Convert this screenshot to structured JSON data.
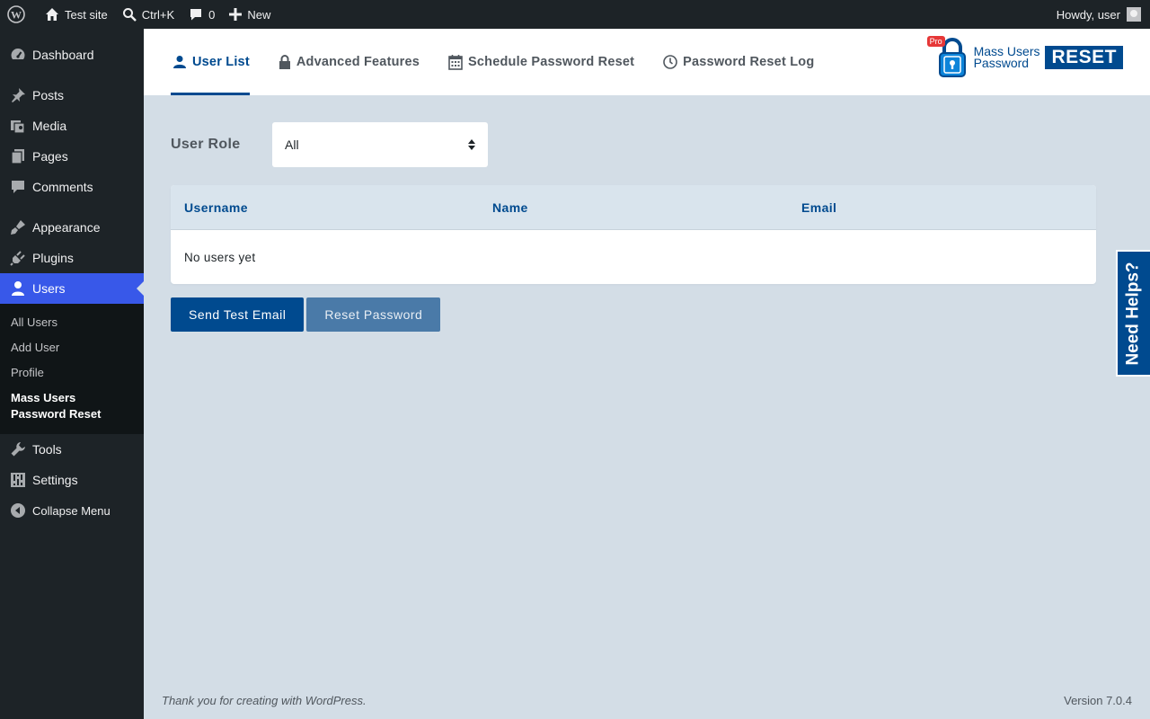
{
  "adminbar": {
    "site_name": "Test site",
    "search_shortcut": "Ctrl+K",
    "comments_count": "0",
    "new_label": "New",
    "howdy": "Howdy, user"
  },
  "sidebar": {
    "items": [
      {
        "label": "Dashboard",
        "icon": "dashboard-icon"
      },
      {
        "label": "Posts",
        "icon": "pin-icon"
      },
      {
        "label": "Media",
        "icon": "media-icon"
      },
      {
        "label": "Pages",
        "icon": "pages-icon"
      },
      {
        "label": "Comments",
        "icon": "comment-icon"
      },
      {
        "label": "Appearance",
        "icon": "brush-icon"
      },
      {
        "label": "Plugins",
        "icon": "plug-icon"
      },
      {
        "label": "Users",
        "icon": "user-icon"
      },
      {
        "label": "Tools",
        "icon": "wrench-icon"
      },
      {
        "label": "Settings",
        "icon": "sliders-icon"
      },
      {
        "label": "Collapse Menu",
        "icon": "collapse-icon"
      }
    ],
    "users_submenu": [
      "All Users",
      "Add User",
      "Profile",
      "Mass Users Password Reset"
    ]
  },
  "plugin": {
    "tabs": [
      {
        "label": "User List",
        "icon": "user-icon"
      },
      {
        "label": "Advanced Features",
        "icon": "lock-icon"
      },
      {
        "label": "Schedule Password Reset",
        "icon": "calendar-icon"
      },
      {
        "label": "Password Reset Log",
        "icon": "clock-icon"
      }
    ],
    "logo": {
      "pro": "Pro",
      "line1": "Mass Users",
      "line2": "Password",
      "reset": "RESET"
    }
  },
  "filter": {
    "label": "User Role",
    "selected": "All"
  },
  "table": {
    "headers": [
      "Username",
      "Name",
      "Email"
    ],
    "empty_message": "No users yet"
  },
  "buttons": {
    "send_test": "Send Test Email",
    "reset": "Reset Password"
  },
  "need_help": "Need Helps?",
  "footer": {
    "thanks": "Thank you for creating with WordPress.",
    "version": "Version 7.0.4"
  },
  "colors": {
    "accent": "#004a8f",
    "wp_blue": "#3858e9",
    "admin_dark": "#1d2327",
    "page_bg": "#d3dde6"
  }
}
